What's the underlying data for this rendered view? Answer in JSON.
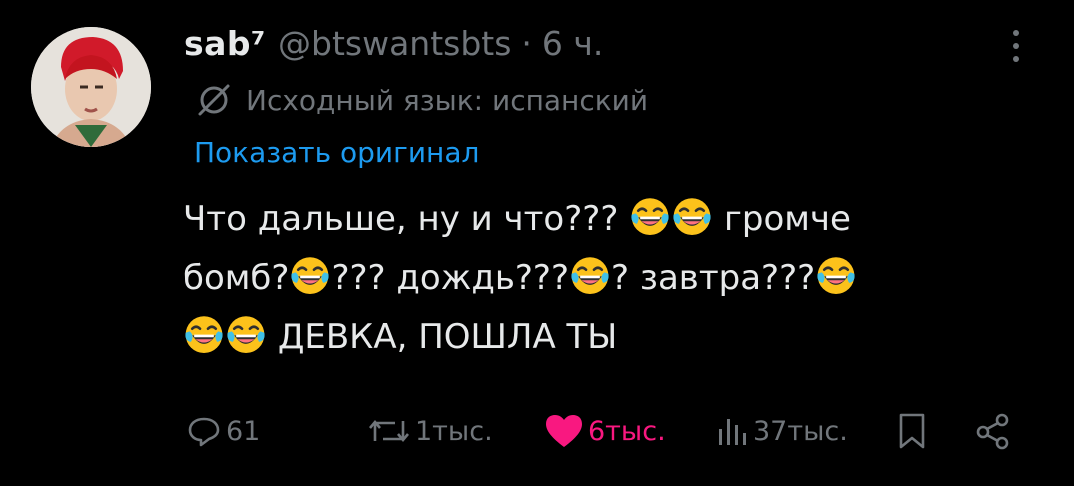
{
  "post": {
    "display_name": "sab⁷",
    "handle": "@btswantsbts",
    "separator": "·",
    "time": "6 ч.",
    "translation_label": "Исходный язык: испанский",
    "show_original_label": "Показать оригинал",
    "text_lines": [
      "Что дальше, ну и что??? 😂😂 громче",
      "бомб?😂??? дождь???😂? завтра???😂",
      "😂😂 ДЕВКА, ПОШЛА ТЫ"
    ],
    "segments": {
      "l1a": "Что дальше, ну и что???",
      "l1b": "громче",
      "l2a": "бомб?",
      "l2b": "??? дождь???",
      "l2c": "? завтра???",
      "l3a": "ДЕВКА, ПОШЛА ТЫ"
    }
  },
  "actions": {
    "reply_count": "61",
    "retweet_count": "1тыс.",
    "like_count": "6тыс.",
    "views_count": "37тыс."
  },
  "icons": {
    "reply": "speech-bubble-icon",
    "retweet": "retweet-arrows-icon",
    "like": "heart-filled-icon",
    "views": "bar-chart-icon",
    "bookmark": "bookmark-icon",
    "share": "share-nodes-icon",
    "more": "vertical-ellipsis-icon",
    "translate": "globe-slash-icon",
    "emoji": "face-with-tears-of-joy"
  },
  "colors": {
    "background": "#000000",
    "text": "#e7e9ea",
    "secondary": "#71767b",
    "link": "#1d9bf0",
    "like": "#f91880"
  }
}
